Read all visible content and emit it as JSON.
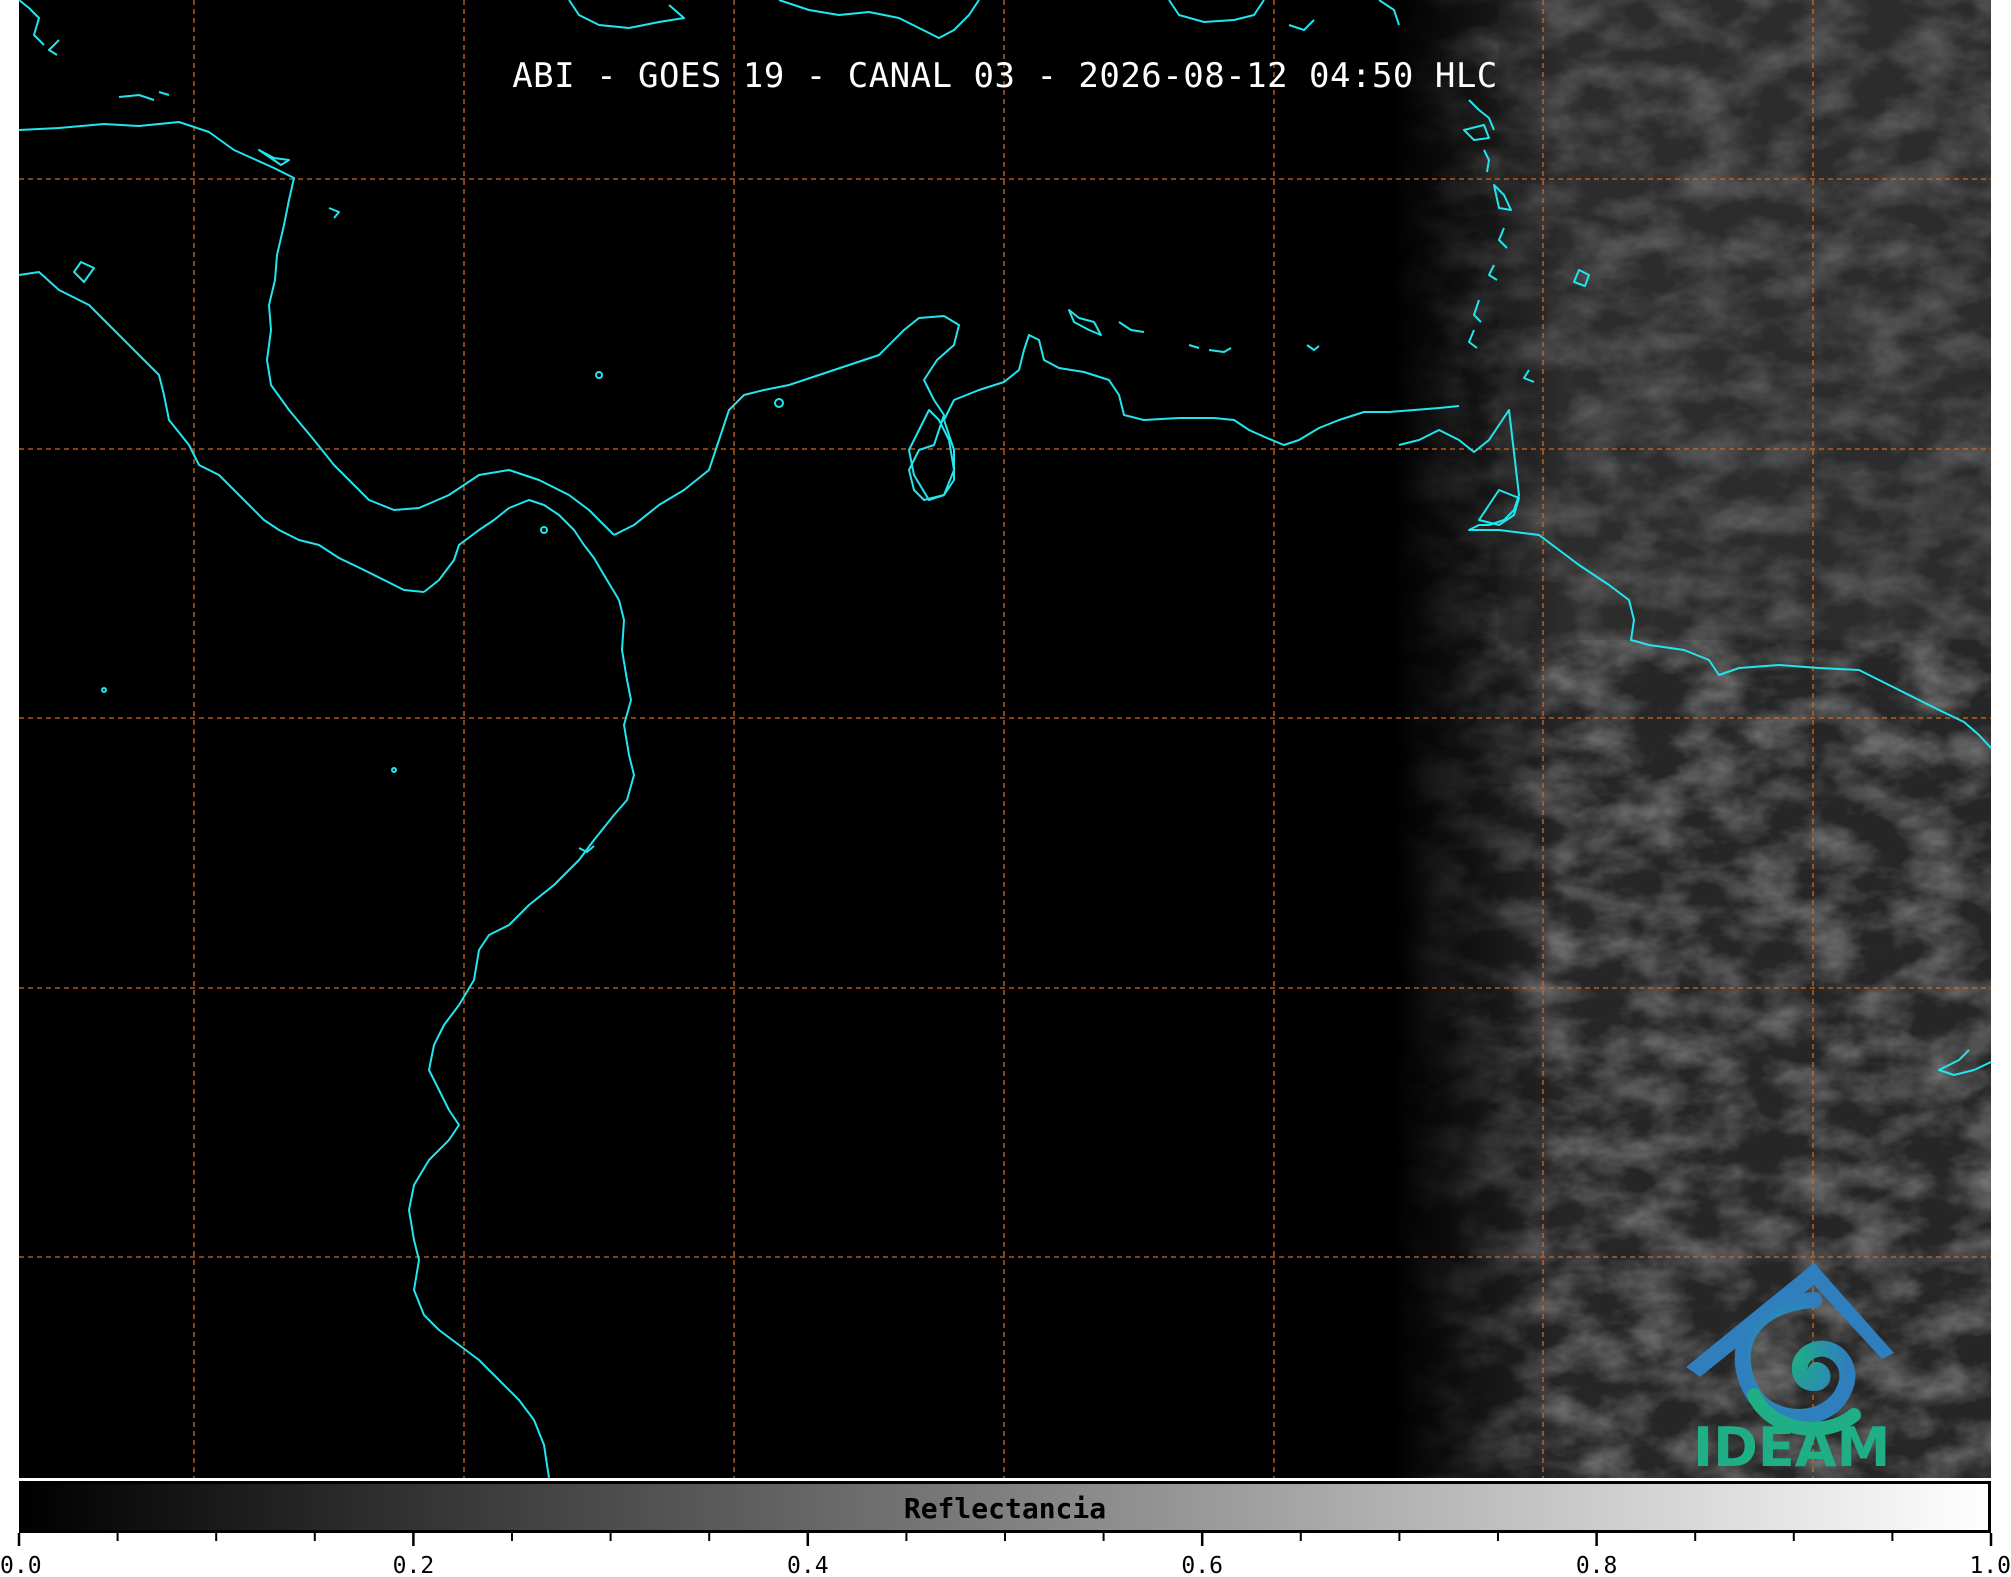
{
  "title": "ABI - GOES 19 - CANAL 03 - 2026-08-12 04:50 HLC",
  "logo": {
    "text": "IDEAM",
    "icon": "ideam-swirl-mountain-logo",
    "colors": [
      "#2f7fbf",
      "#1fae85"
    ]
  },
  "colorbar": {
    "label": "Reflectancia",
    "range": [
      0.0,
      1.0
    ],
    "ticks": [
      "0.0",
      "0.2",
      "0.4",
      "0.6",
      "0.8",
      "1.0"
    ],
    "colormap": [
      "#000000",
      "#ffffff"
    ]
  },
  "map": {
    "coastline_color": "#22e5ee",
    "gridline_color": "#d2691e",
    "gridline_style": "dashed",
    "background": "#000000"
  }
}
